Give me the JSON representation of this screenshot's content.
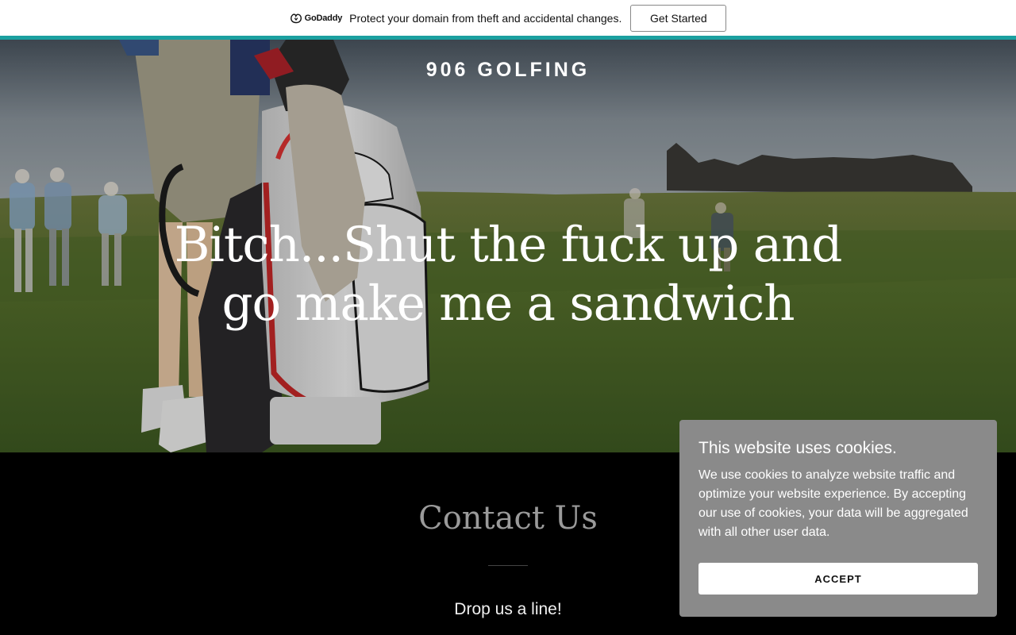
{
  "promo": {
    "logo_text": "GoDaddy",
    "message": "Protect your domain from theft and accidental changes.",
    "button_label": "Get Started",
    "accent_color": "#1ba0a0"
  },
  "hero": {
    "site_title": "906 GOLFING",
    "heading_line1": "Bitch...Shut the fuck up and",
    "heading_line2": "go make me a sandwich"
  },
  "contact": {
    "title": "Contact Us",
    "subtitle": "Drop us a line!"
  },
  "cookie_banner": {
    "title": "This website uses cookies.",
    "text": "We use cookies to analyze website traffic and optimize your website experience. By accepting our use of cookies, your data will be aggregated with all other user data.",
    "accept_label": "ACCEPT"
  }
}
